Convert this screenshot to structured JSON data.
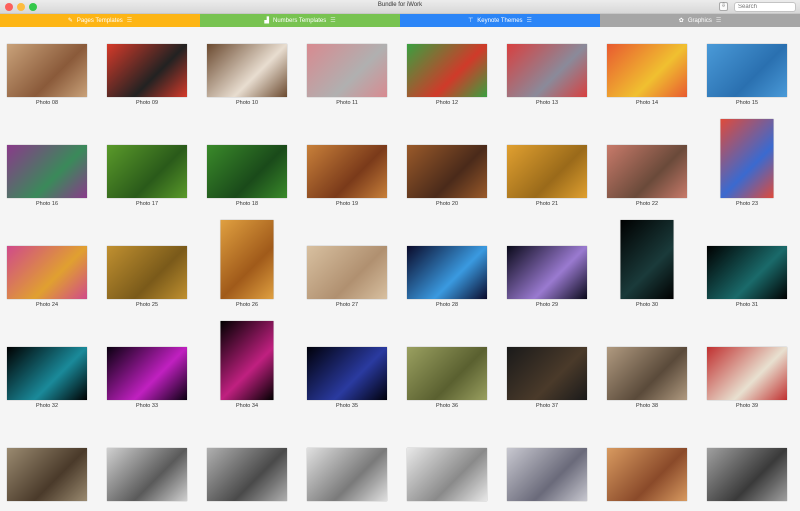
{
  "window": {
    "title": "Bundle for iWork",
    "search_placeholder": "Search",
    "download_icon": "download-icon"
  },
  "traffic_lights": {
    "close": "#fc605c",
    "minimize": "#fdbc40",
    "zoom": "#34c84a"
  },
  "tabs": [
    {
      "label": "Pages Templates",
      "icon": "✎",
      "color": "#fdb515"
    },
    {
      "label": "Numbers Templates",
      "icon": "▟",
      "color": "#78c351"
    },
    {
      "label": "Keynote Themes",
      "icon": "⊤",
      "color": "#2b85f7"
    },
    {
      "label": "Graphics",
      "icon": "✿",
      "color": "#a6a6a6"
    }
  ],
  "photos": [
    {
      "label": "Photo 08",
      "colors": [
        "#c9a27a",
        "#8a5a3a"
      ]
    },
    {
      "label": "Photo 09",
      "colors": [
        "#d63a2a",
        "#222222"
      ]
    },
    {
      "label": "Photo 10",
      "colors": [
        "#6b4a30",
        "#e8ddd0"
      ]
    },
    {
      "label": "Photo 11",
      "colors": [
        "#d88a90",
        "#b0b0b0"
      ]
    },
    {
      "label": "Photo 12",
      "colors": [
        "#3aa040",
        "#d03a2a"
      ]
    },
    {
      "label": "Photo 13",
      "colors": [
        "#d84040",
        "#8a8a9a"
      ]
    },
    {
      "label": "Photo 14",
      "colors": [
        "#e85a30",
        "#f0c030"
      ]
    },
    {
      "label": "Photo 15",
      "colors": [
        "#4a9ad8",
        "#2a70b0"
      ]
    },
    {
      "label": "Photo 16",
      "colors": [
        "#8a3a8a",
        "#3a8a5a"
      ]
    },
    {
      "label": "Photo 17",
      "colors": [
        "#5a9a2a",
        "#2a5a1a"
      ]
    },
    {
      "label": "Photo 18",
      "colors": [
        "#3a8a2a",
        "#1a4a1a"
      ]
    },
    {
      "label": "Photo 19",
      "colors": [
        "#c8803a",
        "#7a3a1a"
      ]
    },
    {
      "label": "Photo 20",
      "colors": [
        "#9a5a2a",
        "#4a2a1a"
      ]
    },
    {
      "label": "Photo 21",
      "colors": [
        "#e0a030",
        "#9a6a1a"
      ]
    },
    {
      "label": "Photo 22",
      "colors": [
        "#c87a6a",
        "#6a4a3a"
      ]
    },
    {
      "label": "Photo 23",
      "colors": [
        "#e04a3a",
        "#3a6ad0"
      ],
      "orientation": "portrait"
    },
    {
      "label": "Photo 24",
      "colors": [
        "#d04a8a",
        "#e0a030"
      ]
    },
    {
      "label": "Photo 25",
      "colors": [
        "#c09030",
        "#7a5a1a"
      ]
    },
    {
      "label": "Photo 26",
      "colors": [
        "#e0a040",
        "#a05a1a"
      ],
      "orientation": "portrait"
    },
    {
      "label": "Photo 27",
      "colors": [
        "#d8c0a0",
        "#b09070"
      ]
    },
    {
      "label": "Photo 28",
      "colors": [
        "#0a0a2a",
        "#3a9ae0"
      ]
    },
    {
      "label": "Photo 29",
      "colors": [
        "#0a0a1a",
        "#9a7ad0"
      ]
    },
    {
      "label": "Photo 30",
      "colors": [
        "#000000",
        "#1a3a3a"
      ],
      "orientation": "portrait"
    },
    {
      "label": "Photo 31",
      "colors": [
        "#000000",
        "#1a6a6a"
      ]
    },
    {
      "label": "Photo 32",
      "colors": [
        "#000000",
        "#1a8a9a"
      ]
    },
    {
      "label": "Photo 33",
      "colors": [
        "#0a0010",
        "#c020c0"
      ]
    },
    {
      "label": "Photo 34",
      "colors": [
        "#000000",
        "#c02080"
      ],
      "orientation": "portrait"
    },
    {
      "label": "Photo 35",
      "colors": [
        "#00000a",
        "#2a3aa0"
      ]
    },
    {
      "label": "Photo 36",
      "colors": [
        "#9aa060",
        "#5a6030"
      ]
    },
    {
      "label": "Photo 37",
      "colors": [
        "#1a1a1a",
        "#4a3a2a"
      ]
    },
    {
      "label": "Photo 38",
      "colors": [
        "#b09a80",
        "#5a4a3a"
      ]
    },
    {
      "label": "Photo 39",
      "colors": [
        "#c03030",
        "#e8e0d0"
      ]
    },
    {
      "label": "",
      "colors": [
        "#9a8a70",
        "#4a3a2a"
      ]
    },
    {
      "label": "",
      "colors": [
        "#d0d0d0",
        "#5a5a5a"
      ]
    },
    {
      "label": "",
      "colors": [
        "#b0b0b0",
        "#4a4a4a"
      ]
    },
    {
      "label": "",
      "colors": [
        "#e0e0e0",
        "#7a7a7a"
      ]
    },
    {
      "label": "",
      "colors": [
        "#e8e8e8",
        "#8a8a8a"
      ]
    },
    {
      "label": "",
      "colors": [
        "#c8c8d0",
        "#6a6a7a"
      ]
    },
    {
      "label": "",
      "colors": [
        "#d89a60",
        "#8a4a2a"
      ]
    },
    {
      "label": "",
      "colors": [
        "#a0a0a0",
        "#3a3a3a"
      ]
    }
  ]
}
